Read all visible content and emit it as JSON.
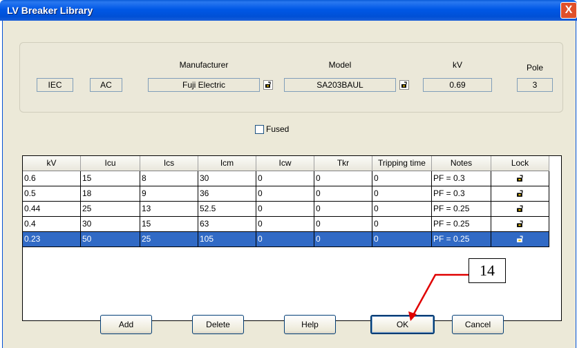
{
  "window": {
    "title": "LV Breaker Library",
    "close_label": "X"
  },
  "header": {
    "standard": "IEC",
    "type": "AC",
    "manufacturer_label": "Manufacturer",
    "manufacturer": "Fuji Electric",
    "model_label": "Model",
    "model": "SA203BAUL",
    "kv_label": "kV",
    "kv": "0.69",
    "pole_label": "Pole",
    "pole": "3"
  },
  "fused": {
    "label": "Fused",
    "checked": false
  },
  "table": {
    "columns": [
      "kV",
      "Icu",
      "Ics",
      "Icm",
      "Icw",
      "Tkr",
      "Tripping time",
      "Notes",
      "Lock"
    ],
    "rows": [
      [
        "0.6",
        "15",
        "8",
        "30",
        "0",
        "0",
        "0",
        "PF = 0.3"
      ],
      [
        "0.5",
        "18",
        "9",
        "36",
        "0",
        "0",
        "0",
        "PF = 0.3"
      ],
      [
        "0.44",
        "25",
        "13",
        "52.5",
        "0",
        "0",
        "0",
        "PF = 0.25"
      ],
      [
        "0.4",
        "30",
        "15",
        "63",
        "0",
        "0",
        "0",
        "PF = 0.25"
      ],
      [
        "0.23",
        "50",
        "25",
        "105",
        "0",
        "0",
        "0",
        "PF = 0.25"
      ]
    ],
    "selected_row": 4
  },
  "buttons": {
    "add": "Add",
    "delete": "Delete",
    "help": "Help",
    "ok": "OK",
    "cancel": "Cancel"
  },
  "annotation": {
    "label": "14",
    "arrow_color": "#e00000"
  }
}
